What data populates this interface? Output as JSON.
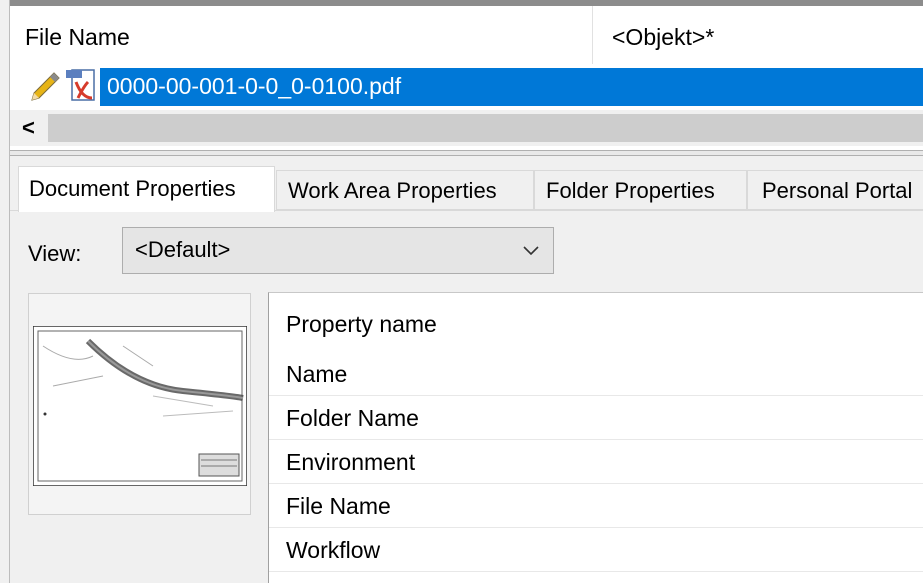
{
  "file_list": {
    "columns": [
      "File Name",
      "<Objekt>*"
    ],
    "rows": [
      {
        "name": "0000-00-001-0-0_0-0100.pdf",
        "selected": true,
        "icons": [
          "pencil-icon",
          "pdf-icon"
        ]
      }
    ],
    "scroll_left_glyph": "<"
  },
  "tabs": [
    {
      "label": "Document Properties",
      "active": true
    },
    {
      "label": "Work Area Properties",
      "active": false
    },
    {
      "label": "Folder Properties",
      "active": false
    },
    {
      "label": "Personal Portal",
      "active": false
    }
  ],
  "view": {
    "label": "View:",
    "selected": "<Default>"
  },
  "properties": {
    "header": "Property name",
    "rows": [
      "Name",
      "Folder Name",
      "Environment",
      "File Name",
      "Workflow"
    ]
  },
  "colors": {
    "selection": "#0078d7",
    "pdf_red": "#c0392b",
    "pencil": "#e0a800"
  }
}
